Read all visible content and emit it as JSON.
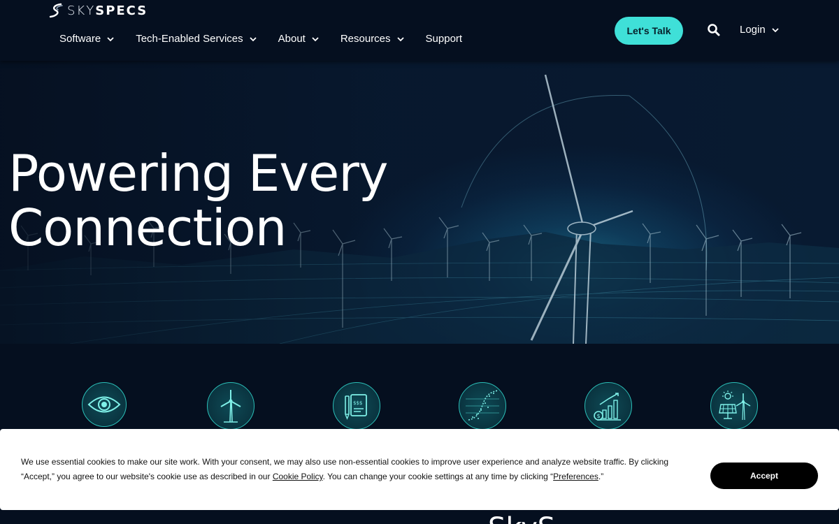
{
  "brand": {
    "logo_light": "SKY",
    "logo_bold": "SPECS"
  },
  "nav": {
    "items": [
      {
        "label": "Software",
        "has_dropdown": true
      },
      {
        "label": "Tech-Enabled Services",
        "has_dropdown": true
      },
      {
        "label": "About",
        "has_dropdown": true
      },
      {
        "label": "Resources",
        "has_dropdown": true
      },
      {
        "label": "Support",
        "has_dropdown": false
      }
    ],
    "cta_label": "Let's Talk",
    "login_label": "Login"
  },
  "hero": {
    "title_line1": "Powering Every",
    "title_line2": "Connection"
  },
  "feature_icons": [
    "eye-icon",
    "wind-turbine-icon",
    "invoice-icon",
    "data-curve-icon",
    "growth-chart-icon",
    "solar-wind-icon"
  ],
  "bottom_heading_partial": "SkyS",
  "cookie": {
    "text_part1": "We use essential cookies to make our site work. With your consent, we may also use non-essential cookies to improve user experience and analyze website traffic. By clicking “Accept,” you agree to our website's cookie use as described in our ",
    "policy_link": "Cookie Policy",
    "text_part2": ". You can change your cookie settings at any time by clicking “",
    "preferences_link": "Preferences",
    "text_part3": ".”",
    "accept_label": "Accept"
  },
  "colors": {
    "accent": "#3fe0d8",
    "background": "#050f1f",
    "icon_stroke": "#2bbfb8"
  }
}
